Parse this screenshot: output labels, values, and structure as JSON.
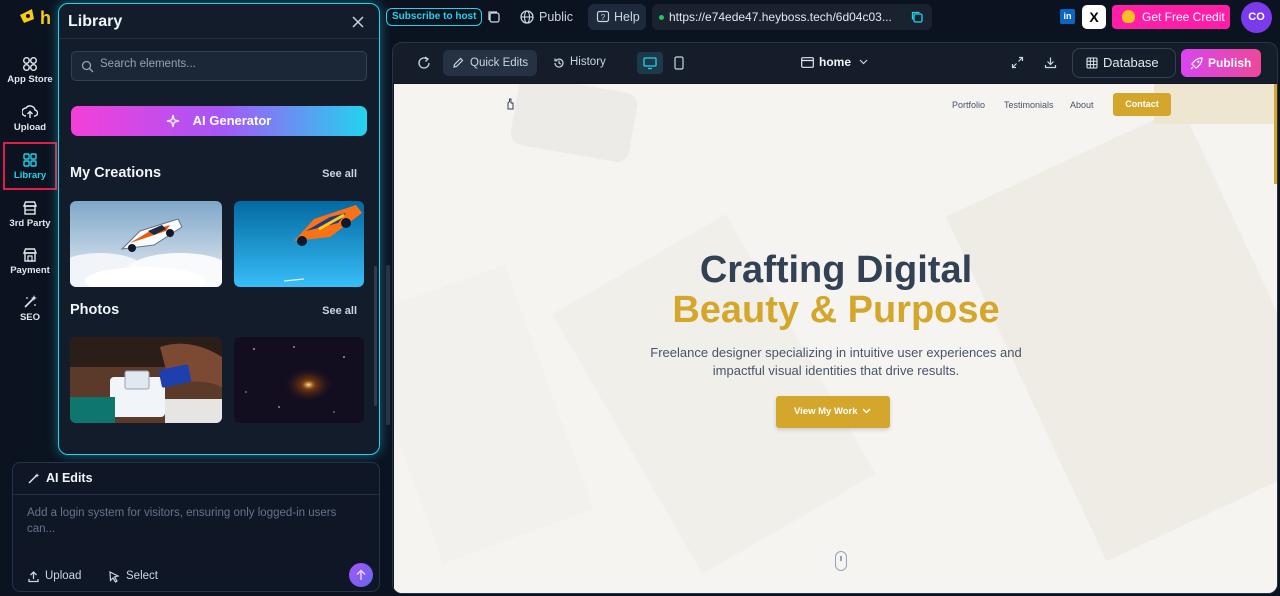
{
  "topbar": {
    "subscribe_label": "Subscribe to host",
    "visibility_label": "Public",
    "help_label": "Help",
    "url": "https://e74ede47.heyboss.tech/6d04c03...",
    "credit_label": "Get Free Credit",
    "avatar_initials": "CO",
    "linkedin_glyph": "in",
    "x_glyph": "X"
  },
  "leftnav": {
    "items": [
      {
        "label": "App Store",
        "icon": "app-store-icon"
      },
      {
        "label": "Upload",
        "icon": "upload-icon"
      },
      {
        "label": "Library",
        "icon": "library-icon",
        "active": true
      },
      {
        "label": "3rd Party",
        "icon": "store-icon"
      },
      {
        "label": "Payment",
        "icon": "payment-icon"
      },
      {
        "label": "SEO",
        "icon": "seo-icon"
      }
    ]
  },
  "library": {
    "title": "Library",
    "search_placeholder": "Search elements...",
    "ai_generator_label": "AI Generator",
    "my_creations_title": "My Creations",
    "photos_title": "Photos",
    "see_all_label": "See all"
  },
  "ai_edits": {
    "title": "AI Edits",
    "prompt_placeholder": "Add a login system for visitors, ensuring only logged-in users can...",
    "upload_label": "Upload",
    "select_label": "Select"
  },
  "editor": {
    "quick_edits_label": "Quick Edits",
    "history_label": "History",
    "page_name": "home",
    "database_label": "Database",
    "publish_label": "Publish"
  },
  "site": {
    "nav": [
      "Portfolio",
      "Testimonials",
      "About"
    ],
    "contact_label": "Contact",
    "hero_line1": "Crafting Digital",
    "hero_line2": "Beauty & Purpose",
    "subtitle": "Freelance designer specializing in intuitive user experiences and impactful visual identities that drive results.",
    "cta_label": "View My Work"
  },
  "colors": {
    "accent_cyan": "#22d3ee",
    "publish_pink": "#ec4899",
    "site_gold": "#d4a72c",
    "site_navy": "#334155"
  }
}
